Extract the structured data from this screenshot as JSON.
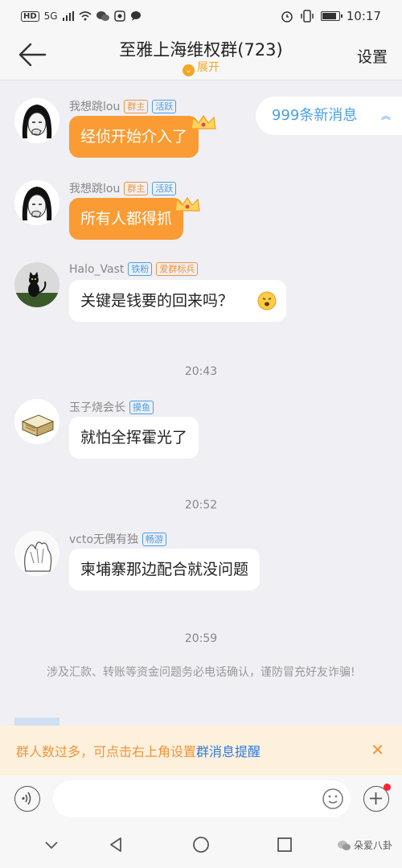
{
  "status_bar": {
    "network": "HD",
    "signal": "5G",
    "time": "10:17"
  },
  "header": {
    "title": "至雅上海维权群(723)",
    "expand_label": "展开",
    "settings_label": "设置"
  },
  "unread_pill": {
    "label": "999条新消息"
  },
  "messages": [
    {
      "nick": "我想跳lou",
      "tags": [
        "群主",
        "活跃"
      ],
      "text": "经侦开始介入了"
    },
    {
      "nick": "我想跳lou",
      "tags": [
        "群主",
        "活跃"
      ],
      "text": "所有人都得抓"
    },
    {
      "nick": "Halo_Vast",
      "tags": [
        "铁粉",
        "爱群标兵"
      ],
      "text": "关键是钱要的回来吗？"
    },
    {
      "nick": "玉子烧会长",
      "tags": [
        "摸鱼"
      ],
      "text": "就怕全挥霍光了"
    },
    {
      "nick": "vcto无偶有独",
      "tags": [
        "畅游"
      ],
      "text": "柬埔寨那边配合就没问题"
    }
  ],
  "timestamps": [
    "20:43",
    "20:52",
    "20:59"
  ],
  "system_notice": "涉及汇款、转账等资金问题务必电话确认，谨防冒充好友诈骗!",
  "banner": {
    "text": "群人数过多，可点击右上角设置",
    "link": "群消息提醒"
  },
  "input": {
    "placeholder": ""
  },
  "watermark": "朵爱八卦",
  "colors": {
    "orange": "#fa9b34",
    "blue_link": "#2e7ce0",
    "banner_bg": "#fdf0dd"
  }
}
